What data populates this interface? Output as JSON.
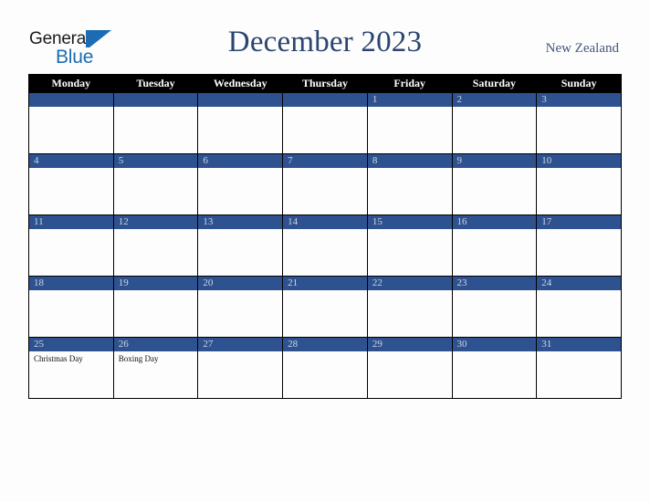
{
  "brand": {
    "name_part1": "General",
    "name_part2": "Blue",
    "triangle_color": "#1b6cb5"
  },
  "header": {
    "title": "December 2023",
    "country": "New Zealand"
  },
  "colors": {
    "header_bar": "#000000",
    "day_number_bar": "#2e5290",
    "day_number_text": "#cfd6e4",
    "title_text": "#2b4570",
    "page_background": "#fdfdfd"
  },
  "calendar": {
    "weekday_headers": [
      "Monday",
      "Tuesday",
      "Wednesday",
      "Thursday",
      "Friday",
      "Saturday",
      "Sunday"
    ],
    "weeks": [
      [
        {
          "day": "",
          "events": []
        },
        {
          "day": "",
          "events": []
        },
        {
          "day": "",
          "events": []
        },
        {
          "day": "",
          "events": []
        },
        {
          "day": "1",
          "events": []
        },
        {
          "day": "2",
          "events": []
        },
        {
          "day": "3",
          "events": []
        }
      ],
      [
        {
          "day": "4",
          "events": []
        },
        {
          "day": "5",
          "events": []
        },
        {
          "day": "6",
          "events": []
        },
        {
          "day": "7",
          "events": []
        },
        {
          "day": "8",
          "events": []
        },
        {
          "day": "9",
          "events": []
        },
        {
          "day": "10",
          "events": []
        }
      ],
      [
        {
          "day": "11",
          "events": []
        },
        {
          "day": "12",
          "events": []
        },
        {
          "day": "13",
          "events": []
        },
        {
          "day": "14",
          "events": []
        },
        {
          "day": "15",
          "events": []
        },
        {
          "day": "16",
          "events": []
        },
        {
          "day": "17",
          "events": []
        }
      ],
      [
        {
          "day": "18",
          "events": []
        },
        {
          "day": "19",
          "events": []
        },
        {
          "day": "20",
          "events": []
        },
        {
          "day": "21",
          "events": []
        },
        {
          "day": "22",
          "events": []
        },
        {
          "day": "23",
          "events": []
        },
        {
          "day": "24",
          "events": []
        }
      ],
      [
        {
          "day": "25",
          "events": [
            "Christmas Day"
          ]
        },
        {
          "day": "26",
          "events": [
            "Boxing Day"
          ]
        },
        {
          "day": "27",
          "events": []
        },
        {
          "day": "28",
          "events": []
        },
        {
          "day": "29",
          "events": []
        },
        {
          "day": "30",
          "events": []
        },
        {
          "day": "31",
          "events": []
        }
      ]
    ]
  }
}
